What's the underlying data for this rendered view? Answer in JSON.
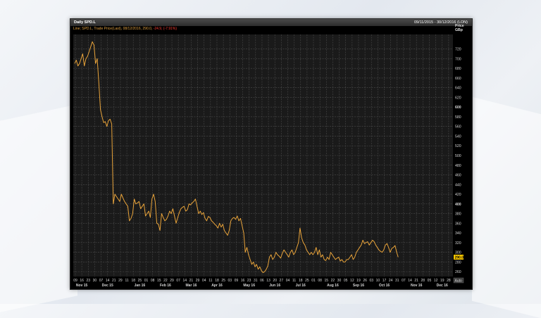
{
  "window": {
    "title": "Daily SPD.L",
    "date_range": "09/11/2015 - 30/12/2016 (LON)"
  },
  "legend": {
    "text": "Line; SPD.L, Trade Price(Last), 08/12/2016, 290.0,",
    "change": "-24.9, (-7.91%)"
  },
  "axis": {
    "price_label_1": "Price",
    "price_label_2": "GBp",
    "current_price": "290.0",
    "auto_label": "Auto"
  },
  "colors": {
    "line": "#e8a33a",
    "grid": "#4a4a4a",
    "plot_bg": "#1a1a1a",
    "change": "#ff3b30",
    "price_tag_bg": "#ffcc00"
  },
  "chart_data": {
    "type": "line",
    "title": "Daily SPD.L",
    "ylabel": "Price GBp",
    "ylim": [
      250,
      750
    ],
    "yticks": [
      260,
      280,
      300,
      320,
      340,
      360,
      380,
      400,
      420,
      440,
      460,
      480,
      500,
      520,
      540,
      560,
      580,
      600,
      620,
      640,
      660,
      680,
      700,
      720
    ],
    "bold_yticks": [
      400,
      600
    ],
    "x_day_ticks": [
      "09",
      "16",
      "23",
      "30",
      "07",
      "14",
      "21",
      "29",
      "11",
      "18",
      "25",
      "01",
      "08",
      "15",
      "22",
      "29",
      "07",
      "14",
      "21",
      "29",
      "04",
      "11",
      "18",
      "25",
      "03",
      "09",
      "16",
      "23",
      "31",
      "06",
      "13",
      "20",
      "27",
      "04",
      "11",
      "18",
      "25",
      "01",
      "08",
      "15",
      "22",
      "30",
      "05",
      "12",
      "19",
      "26",
      "03",
      "10",
      "17",
      "24",
      "31",
      "07",
      "14",
      "21",
      "28",
      "05",
      "12",
      "19",
      "28"
    ],
    "month_labels": [
      "Nov 15",
      "Dec 15",
      "Jan 16",
      "Feb 16",
      "Mar 16",
      "Apr 16",
      "May 16",
      "Jun 16",
      "Jul 16",
      "Aug 16",
      "Sep 16",
      "Oct 16",
      "Nov 16",
      "Dec 16"
    ],
    "month_label_ticks": [
      1,
      5,
      10,
      14,
      18,
      22,
      27,
      31,
      35,
      40,
      44,
      48,
      53,
      57
    ],
    "grid": true,
    "series": [
      {
        "values": [
          690,
          697,
          685,
          690,
          700,
          710,
          685,
          700,
          705,
          715,
          725,
          735,
          728,
          690,
          700,
          650,
          595,
          580,
          568,
          570,
          560,
          572,
          575,
          565,
          400,
          420,
          415,
          410,
          405,
          420,
          412,
          405,
          400,
          395,
          365,
          370,
          380,
          410,
          400,
          402,
          405,
          390,
          395,
          400,
          375,
          380,
          385,
          372,
          410,
          420,
          405,
          360,
          358,
          345,
          380,
          372,
          365,
          368,
          375,
          385,
          380,
          390,
          375,
          360,
          372,
          382,
          390,
          393,
          395,
          385,
          388,
          400,
          398,
          402,
          405,
          410,
          395,
          380,
          385,
          378,
          382,
          370,
          365,
          374,
          372,
          365,
          362,
          358,
          355,
          350,
          360,
          352,
          358,
          345,
          340,
          335,
          345,
          365,
          370,
          372,
          368,
          375,
          365,
          370,
          355,
          340,
          300,
          310,
          295,
          285,
          275,
          280,
          270,
          275,
          265,
          270,
          262,
          258,
          260,
          265,
          272,
          290,
          295,
          285,
          290,
          300,
          295,
          292,
          288,
          298,
          305,
          300,
          295,
          290,
          300,
          305,
          295,
          300,
          310,
          320,
          350,
          330,
          320,
          315,
          305,
          300,
          295,
          300,
          295,
          300,
          310,
          295,
          305,
          290,
          295,
          285,
          283,
          290,
          285,
          300,
          295,
          290,
          285,
          288,
          290,
          282,
          285,
          280,
          280,
          285,
          285,
          290,
          295,
          285,
          290,
          300,
          305,
          310,
          315,
          325,
          318,
          320,
          322,
          315,
          320,
          325,
          322,
          315,
          310,
          305,
          302,
          300,
          305,
          315,
          318,
          310,
          300,
          308,
          310,
          314,
          300,
          290
        ]
      }
    ]
  }
}
